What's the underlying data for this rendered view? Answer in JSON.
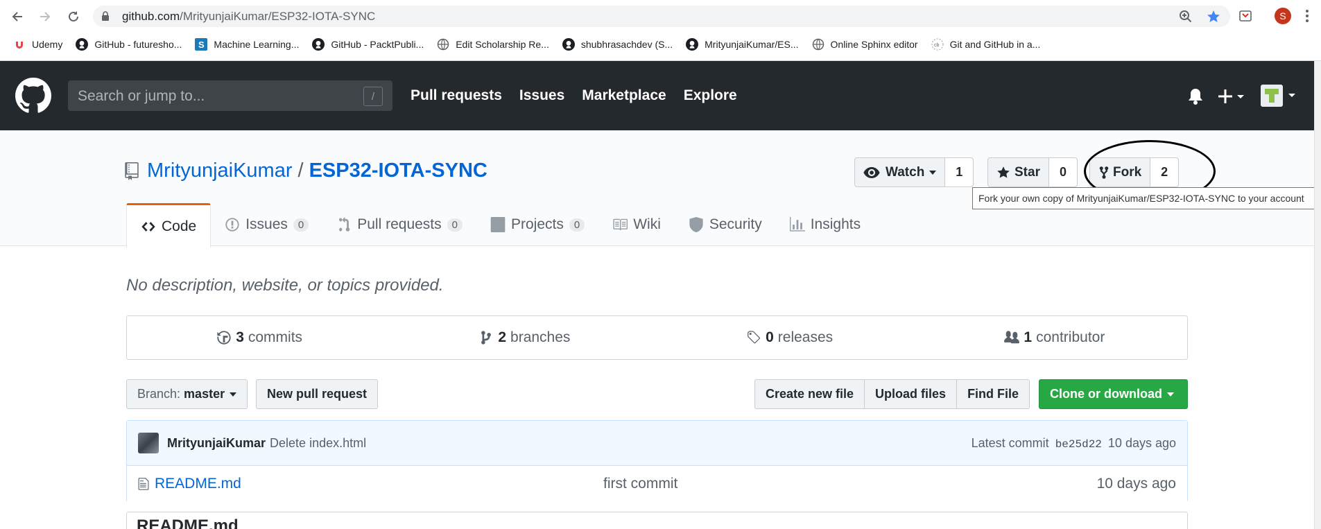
{
  "browser": {
    "url_host": "github.com",
    "url_path": "/MrityunjaiKumar/ESP32-IOTA-SYNC",
    "profile_initial": "S",
    "bookmarks": [
      {
        "label": "Udemy",
        "icon": "udemy-icon"
      },
      {
        "label": "GitHub - futuresho...",
        "icon": "github-icon"
      },
      {
        "label": "Machine Learning...",
        "icon": "scribd-icon"
      },
      {
        "label": "GitHub - PacktPubli...",
        "icon": "github-icon"
      },
      {
        "label": "Edit Scholarship Re...",
        "icon": "globe-icon"
      },
      {
        "label": "shubhrasachdev (S...",
        "icon": "github-icon"
      },
      {
        "label": "MrityunjaiKumar/ES...",
        "icon": "github-icon"
      },
      {
        "label": "Online Sphinx editor",
        "icon": "globe-icon"
      },
      {
        "label": "Git and GitHub in a...",
        "icon": "cb-icon"
      }
    ]
  },
  "header": {
    "search_placeholder": "Search or jump to...",
    "search_shortcut": "/",
    "nav": [
      "Pull requests",
      "Issues",
      "Marketplace",
      "Explore"
    ]
  },
  "repo": {
    "owner": "MrityunjaiKumar",
    "separator": "/",
    "name": "ESP32-IOTA-SYNC",
    "watch_label": "Watch",
    "watch_count": "1",
    "star_label": "Star",
    "star_count": "0",
    "fork_label": "Fork",
    "fork_count": "2",
    "fork_tooltip": "Fork your own copy of MrityunjaiKumar/ESP32-IOTA-SYNC to your account",
    "tabs": [
      {
        "label": "Code",
        "count": ""
      },
      {
        "label": "Issues",
        "count": "0"
      },
      {
        "label": "Pull requests",
        "count": "0"
      },
      {
        "label": "Projects",
        "count": "0"
      },
      {
        "label": "Wiki",
        "count": ""
      },
      {
        "label": "Security",
        "count": ""
      },
      {
        "label": "Insights",
        "count": ""
      }
    ],
    "description": "No description, website, or topics provided.",
    "summary": {
      "commits_num": "3",
      "commits_label": "commits",
      "branches_num": "2",
      "branches_label": "branches",
      "releases_num": "0",
      "releases_label": "releases",
      "contributors_num": "1",
      "contributors_label": "contributor"
    },
    "branch_prefix": "Branch:",
    "branch_name": "master",
    "new_pr": "New pull request",
    "create_file": "Create new file",
    "upload_files": "Upload files",
    "find_file": "Find File",
    "clone": "Clone or download",
    "commit": {
      "author": "MrityunjaiKumar",
      "message": "Delete index.html",
      "latest_label": "Latest commit",
      "sha": "be25d22",
      "age": "10 days ago"
    },
    "files": [
      {
        "name": "README.md",
        "message": "first commit",
        "age": "10 days ago"
      }
    ],
    "readme_title": "README.md"
  },
  "colors": {
    "header_bg": "#24292e",
    "link": "#0366d6",
    "active_tab_accent": "#e36209",
    "clone_green": "#28a745"
  }
}
